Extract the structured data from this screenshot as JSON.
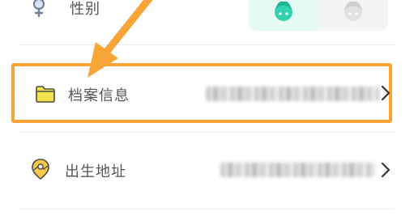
{
  "gender_row": {
    "label": "性别",
    "icon": "female-symbol-icon",
    "options": [
      {
        "name": "male",
        "icon": "boy-avatar-icon",
        "selected": true
      },
      {
        "name": "female",
        "icon": "girl-avatar-icon",
        "selected": false
      }
    ]
  },
  "archive_row": {
    "label": "档案信息",
    "icon": "folder-icon",
    "value_blurred": true,
    "highlighted": true
  },
  "birthplace_row": {
    "label": "出生地址",
    "icon": "map-pin-icon",
    "value_blurred": true
  },
  "annotation": {
    "type": "arrow",
    "icon": "annotation-arrow-icon"
  },
  "colors": {
    "highlight_border": "#f7a536",
    "arrow": "#f7a536",
    "selected_option_bg": "#e6faf4",
    "unselected_option_bg": "#f4f4f4",
    "label_text": "#555555"
  }
}
